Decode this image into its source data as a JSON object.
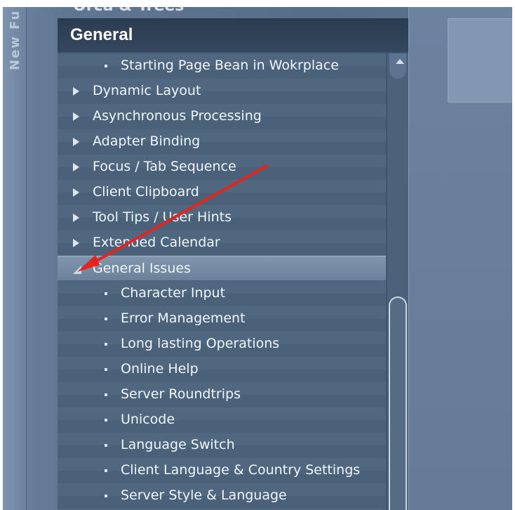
{
  "window": {
    "side_tab": "New Fu",
    "partial_heading": "Orca & Trees"
  },
  "panel": {
    "title": "General",
    "items": [
      {
        "label": "Starting Page Bean in Wokrplace",
        "type": "child"
      },
      {
        "label": "Dynamic Layout",
        "type": "collapsed"
      },
      {
        "label": "Asynchronous Processing",
        "type": "collapsed"
      },
      {
        "label": "Adapter Binding",
        "type": "collapsed"
      },
      {
        "label": "Focus / Tab Sequence",
        "type": "collapsed"
      },
      {
        "label": "Client Clipboard",
        "type": "collapsed"
      },
      {
        "label": "Tool Tips / User Hints",
        "type": "collapsed"
      },
      {
        "label": "Extended Calendar",
        "type": "collapsed"
      },
      {
        "label": "General Issues",
        "type": "expanded-selected"
      },
      {
        "label": "Character Input",
        "type": "child"
      },
      {
        "label": "Error Management",
        "type": "child"
      },
      {
        "label": "Long lasting Operations",
        "type": "child"
      },
      {
        "label": "Online Help",
        "type": "child"
      },
      {
        "label": "Server Roundtrips",
        "type": "child"
      },
      {
        "label": "Unicode",
        "type": "child"
      },
      {
        "label": "Language Switch",
        "type": "child"
      },
      {
        "label": "Client Language & Country Settings",
        "type": "child"
      },
      {
        "label": "Server Style & Language",
        "type": "child"
      }
    ]
  },
  "annotation": {
    "arrow_color": "#e8221c",
    "points_to": "General Issues"
  },
  "colors": {
    "panel_bg": "#3f5671",
    "header_bg": "#2c3c50",
    "selected_row": "#7f96ad",
    "text": "#f1f4f8"
  }
}
